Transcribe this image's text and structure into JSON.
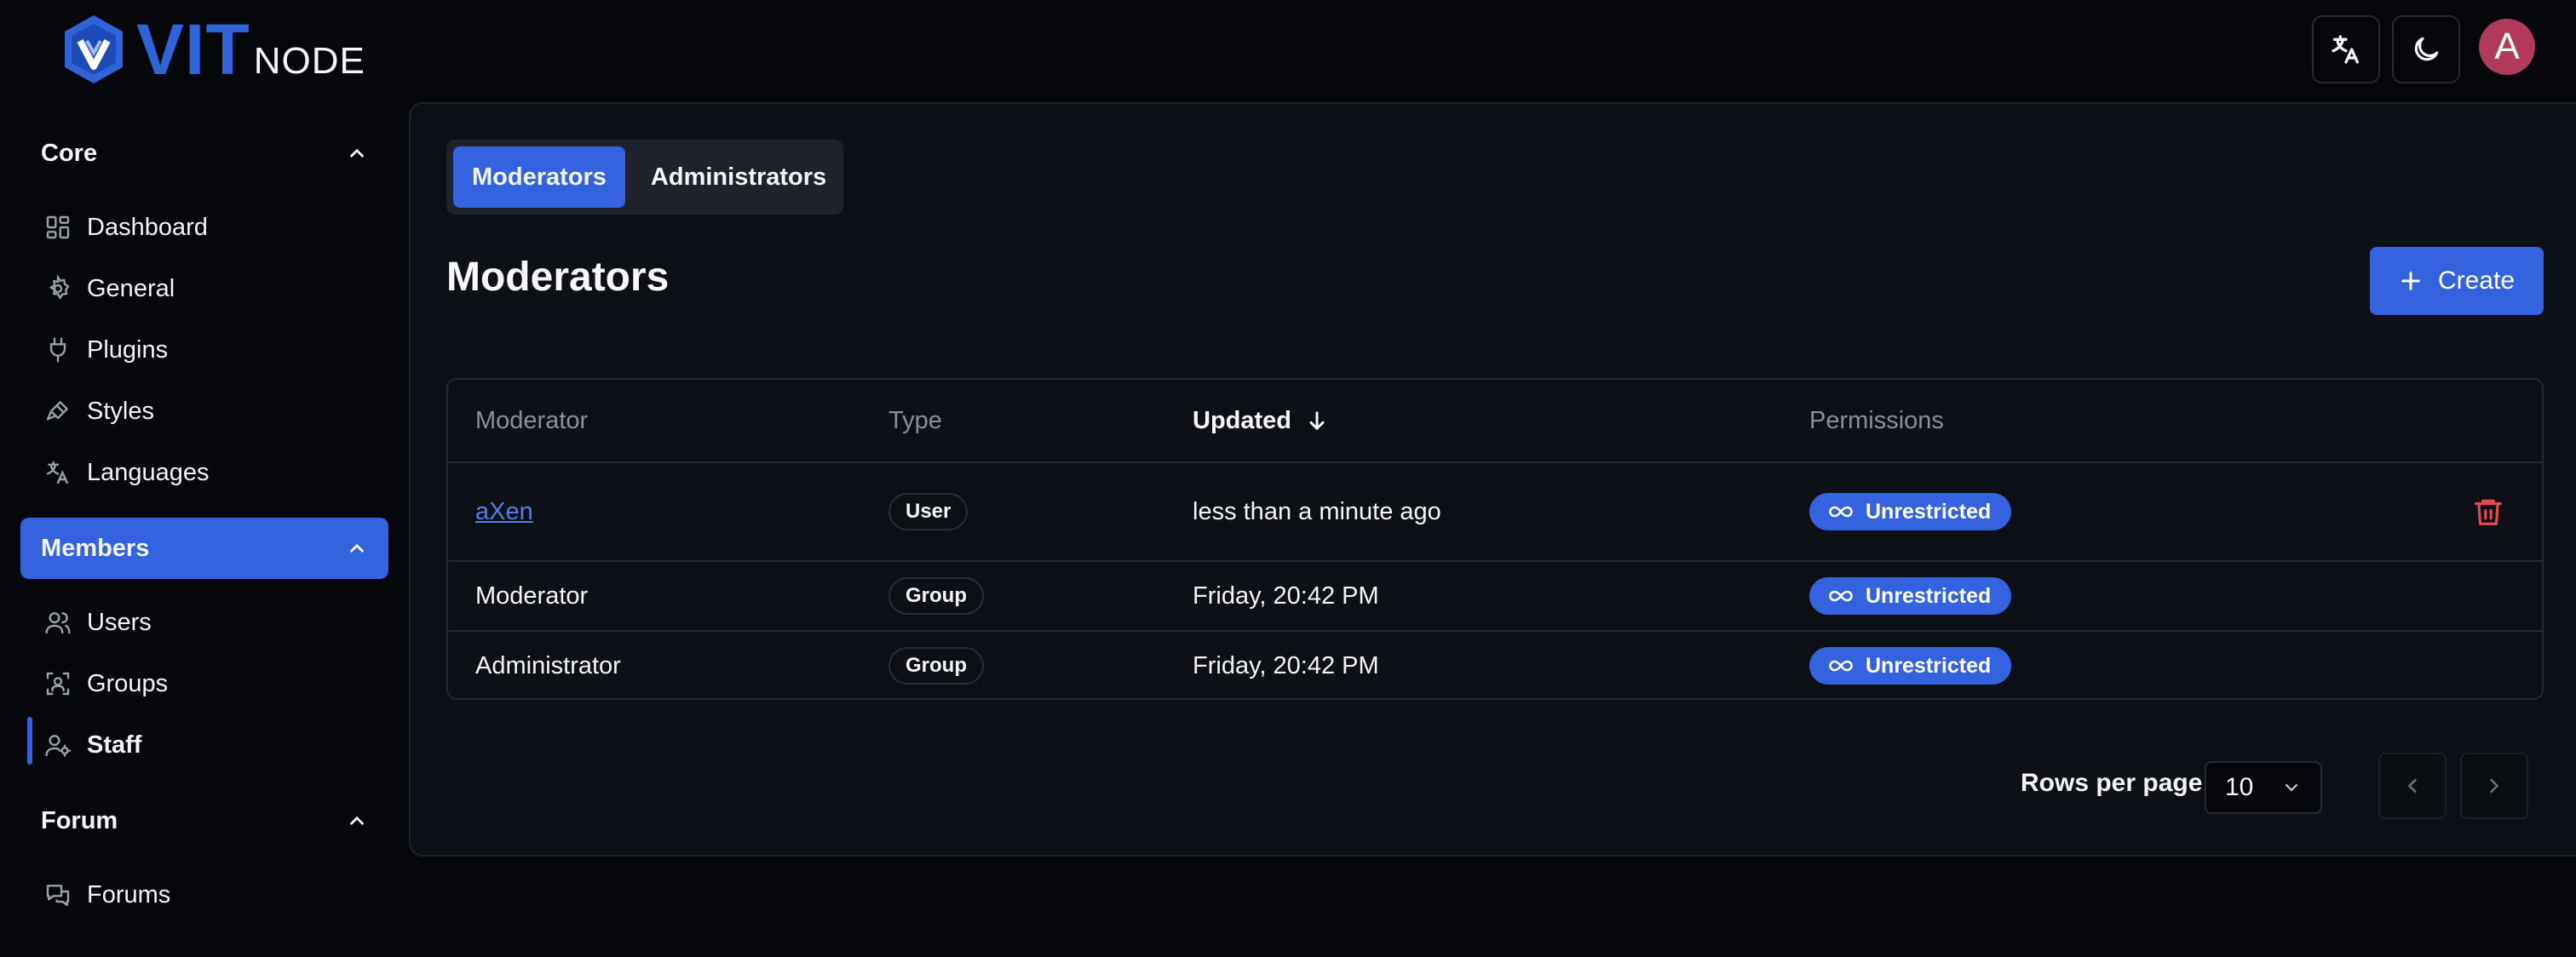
{
  "brand": {
    "vit": "VIT",
    "node": "NODE"
  },
  "header": {
    "translate_button": "translate-icon",
    "theme_button": "moon-icon",
    "avatar_letter": "A"
  },
  "sidebar": {
    "sections": [
      {
        "label": "Core",
        "items": [
          "Dashboard",
          "General",
          "Plugins",
          "Styles",
          "Languages"
        ]
      },
      {
        "label": "Members",
        "active": true,
        "items": [
          "Users",
          "Groups",
          "Staff"
        ]
      },
      {
        "label": "Forum",
        "items": [
          "Forums"
        ]
      }
    ],
    "core": {
      "label": "Core",
      "dashboard": "Dashboard",
      "general": "General",
      "plugins": "Plugins",
      "styles": "Styles",
      "languages": "Languages"
    },
    "members": {
      "label": "Members",
      "users": "Users",
      "groups": "Groups",
      "staff": "Staff"
    },
    "forum": {
      "label": "Forum",
      "forums": "Forums"
    }
  },
  "tabs": {
    "moderators": "Moderators",
    "administrators": "Administrators"
  },
  "main": {
    "title": "Moderators",
    "create_label": "Create"
  },
  "table": {
    "columns": {
      "moderator": "Moderator",
      "type": "Type",
      "updated": "Updated",
      "permissions": "Permissions"
    },
    "rows": [
      {
        "moderator": "aXen",
        "type": "User",
        "updated": "less than a minute ago",
        "permissions": "Unrestricted"
      },
      {
        "moderator": "Moderator",
        "type": "Group",
        "updated": "Friday, 20:42 PM",
        "permissions": "Unrestricted"
      },
      {
        "moderator": "Administrator",
        "type": "Group",
        "updated": "Friday, 20:42 PM",
        "permissions": "Unrestricted"
      }
    ]
  },
  "pagination": {
    "rows_per_page_label": "Rows per page",
    "rows_per_page_value": "10"
  },
  "colors": {
    "accent": "#3563e0",
    "background": "#05070b",
    "panel": "#0d1016",
    "danger": "#e5484d",
    "avatar": "#b13a5c"
  }
}
